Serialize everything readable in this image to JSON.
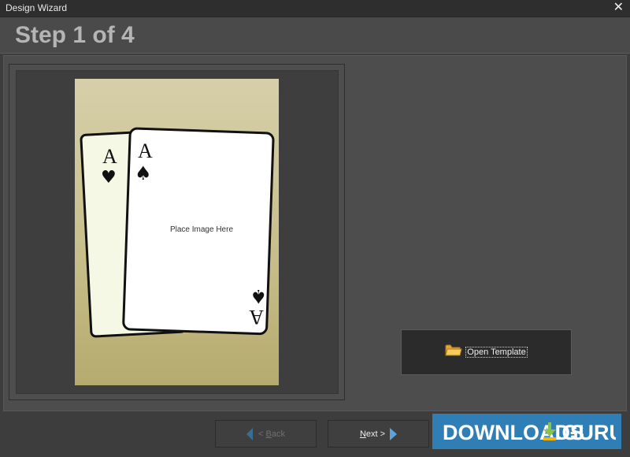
{
  "window": {
    "title": "Design Wizard",
    "close_glyph": "✕"
  },
  "header": {
    "step_label": "Step 1 of 4"
  },
  "preview": {
    "placeholder": "Place Image Here",
    "back_card": {
      "rank": "A",
      "suit": "♥"
    },
    "front_card": {
      "rank": "A",
      "suit": "♠"
    }
  },
  "actions": {
    "open_template_label": "Open Template",
    "open_template_icon": "folder-icon"
  },
  "footer": {
    "back": {
      "prefix": "< ",
      "accel": "B",
      "rest": "ack"
    },
    "next": {
      "accel": "N",
      "rest": "ext >"
    }
  },
  "watermark": {
    "text_left": "DOWNLOADS",
    "text_right": ".GURU"
  },
  "colors": {
    "accent_blue": "#5ba3dc",
    "watermark_bg": "#2f7fb6",
    "card_bg_top": "#d6cfa9",
    "card_bg_bottom": "#b5aa6e"
  }
}
